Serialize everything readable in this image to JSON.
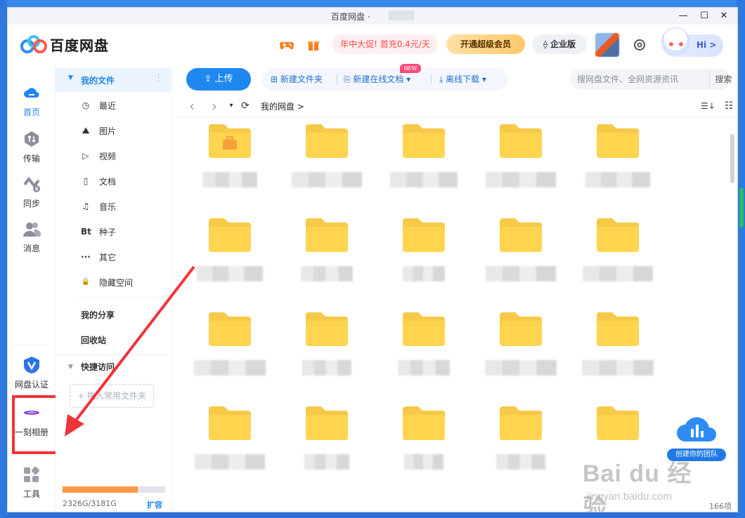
{
  "window": {
    "title": "百度网盘",
    "title_sep": "·",
    "minimize": "—",
    "maximize": "☐",
    "close": "✕"
  },
  "header": {
    "logo_text": "百度网盘",
    "promo": "年中大促! 首充0.4元/天",
    "vip_button": "开通超级会员",
    "enterprise_button": "企业版",
    "hi_label": "Hi >"
  },
  "rail": {
    "items": [
      {
        "label": "首页",
        "icon": "cloud-home-icon",
        "active": true
      },
      {
        "label": "传输",
        "icon": "transfer-icon",
        "active": false
      },
      {
        "label": "同步",
        "icon": "sync-icon",
        "active": false
      },
      {
        "label": "消息",
        "icon": "message-icon",
        "active": false
      }
    ],
    "bottom": [
      {
        "label": "网盘认证",
        "icon": "verify-icon"
      },
      {
        "label": "一刻相册",
        "icon": "album-icon"
      },
      {
        "label": "工具",
        "icon": "tools-icon"
      }
    ]
  },
  "sidebar": {
    "my_files": "我的文件",
    "items": [
      {
        "label": "最近",
        "icon": "clock-icon",
        "glyph": "◷"
      },
      {
        "label": "图片",
        "icon": "image-icon",
        "glyph": "⛰"
      },
      {
        "label": "视频",
        "icon": "video-icon",
        "glyph": "▷"
      },
      {
        "label": "文档",
        "icon": "document-icon",
        "glyph": "▯"
      },
      {
        "label": "音乐",
        "icon": "music-icon",
        "glyph": "♫"
      },
      {
        "label": "种子",
        "icon": "torrent-icon",
        "glyph": "Bt"
      },
      {
        "label": "其它",
        "icon": "more-icon",
        "glyph": "···"
      },
      {
        "label": "隐藏空间",
        "icon": "lock-icon",
        "glyph": "🔒"
      }
    ],
    "my_share": "我的分享",
    "recycle": "回收站",
    "quick_access": "快捷访问",
    "drop_hint": "+ 拖入常用文件夹",
    "quota_text": "2326G/3181G",
    "quota_fraction": 0.731,
    "expand": "扩容"
  },
  "toolbar": {
    "upload": "上传",
    "new_folder": "新建文件夹",
    "new_online_doc": "新建在线文档",
    "new_badge": "NEW",
    "offline_download": "离线下载",
    "search_placeholder": "搜网盘文件、全网资源资讯",
    "search_button": "搜索"
  },
  "nav": {
    "back": "‹",
    "forward": "›",
    "dropdown": "▾",
    "refresh": "⟳",
    "breadcrumb": "我的网盘  >",
    "sort": "☰↓",
    "view": "☷"
  },
  "files": {
    "count_label": "166项"
  },
  "team": {
    "label": "创建你的团队"
  },
  "watermark": {
    "main": "Bai du 经验",
    "sub": "jingyan.baidu.com"
  },
  "colors": {
    "accent": "#1f87f0",
    "folder": "#ffd54f",
    "highlight": "#f2333a"
  }
}
